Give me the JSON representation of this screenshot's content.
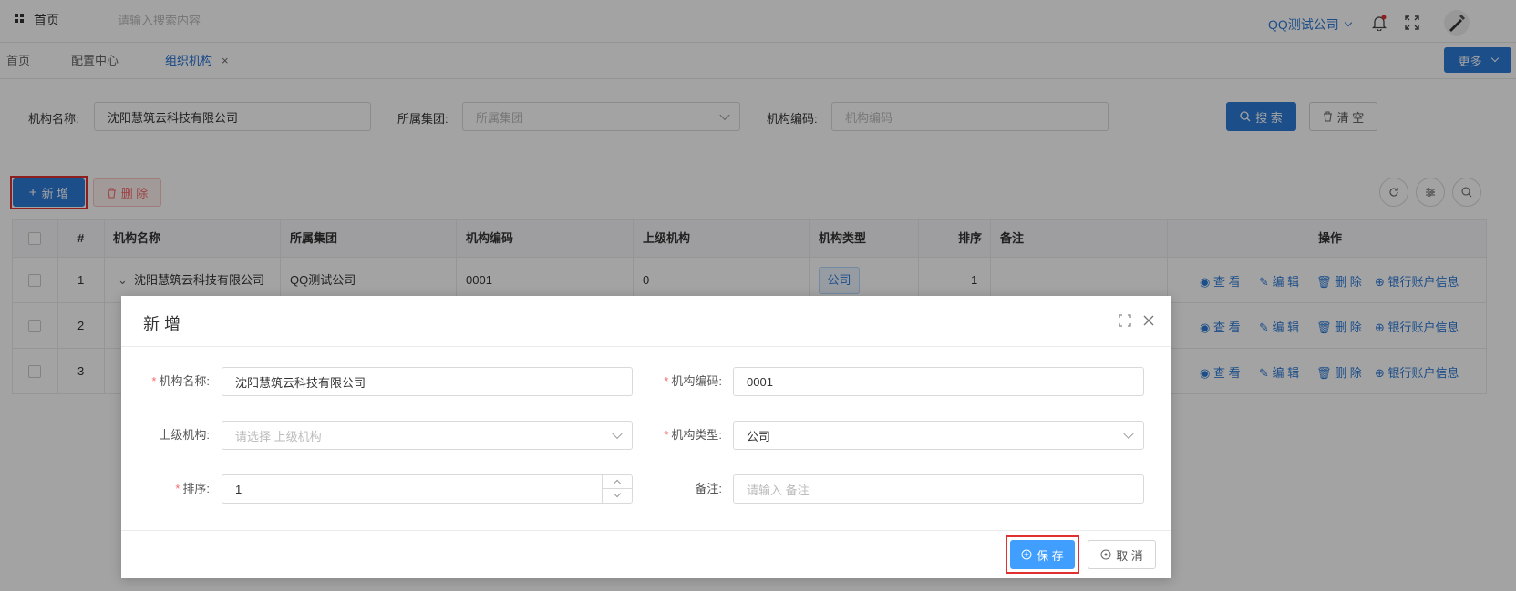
{
  "topbar": {
    "home_label": "首页",
    "search_placeholder": "请输入搜索内容",
    "company": "QQ测试公司"
  },
  "tabs": [
    {
      "label": "首页"
    },
    {
      "label": "配置中心"
    },
    {
      "label": "组织机构",
      "close": "×"
    }
  ],
  "more_label": "更多",
  "filter": {
    "name_label": "机构名称:",
    "name_value": "沈阳慧筑云科技有限公司",
    "group_label": "所属集团:",
    "group_placeholder": "所属集团",
    "code_label": "机构编码:",
    "code_placeholder": "机构编码",
    "search_label": "搜 索",
    "clear_label": "清 空"
  },
  "toolbar": {
    "add_label": "新 增",
    "delete_label": "删 除"
  },
  "table": {
    "headers": [
      "#",
      "机构名称",
      "所属集团",
      "机构编码",
      "上级机构",
      "机构类型",
      "排序",
      "备注",
      "操作"
    ],
    "rows": [
      {
        "no": "1",
        "name": "沈阳慧筑云科技有限公司",
        "group": "QQ测试公司",
        "code": "0001",
        "parent": "0",
        "type": "公司",
        "sort": "1"
      },
      {
        "no": "2"
      },
      {
        "no": "3"
      }
    ],
    "actions": {
      "view": "查 看",
      "edit": "编 辑",
      "delete": "删 除",
      "bank": "银行账户信息"
    }
  },
  "dialog": {
    "title": "新 增",
    "fields": {
      "name_label": "机构名称:",
      "name_value": "沈阳慧筑云科技有限公司",
      "code_label": "机构编码:",
      "code_value": "0001",
      "parent_label": "上级机构:",
      "parent_placeholder": "请选择 上级机构",
      "type_label": "机构类型:",
      "type_value": "公司",
      "sort_label": "排序:",
      "sort_value": "1",
      "remark_label": "备注:",
      "remark_placeholder": "请输入 备注",
      "required_mark": "*"
    },
    "save_label": "保 存",
    "cancel_label": "取 消"
  },
  "colors": {
    "primary": "#2d7ad8",
    "highlight": "#e03030",
    "danger": "#f56c6c"
  }
}
